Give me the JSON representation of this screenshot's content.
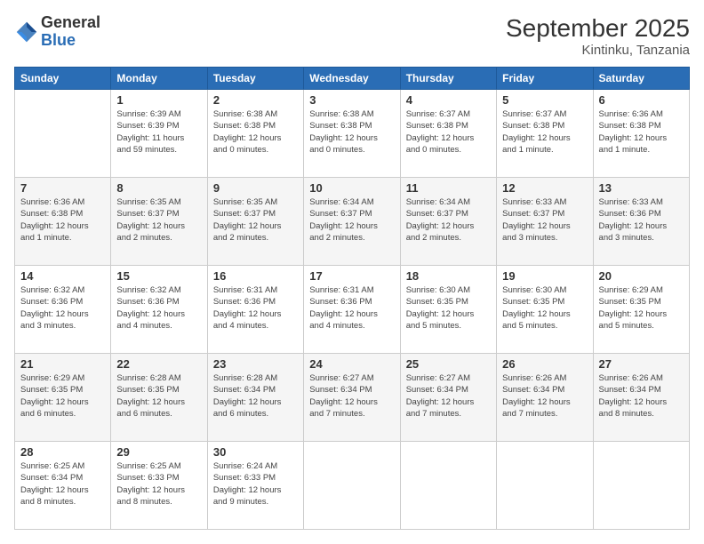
{
  "logo": {
    "general": "General",
    "blue": "Blue"
  },
  "header": {
    "title": "September 2025",
    "subtitle": "Kintinku, Tanzania"
  },
  "calendar": {
    "days_of_week": [
      "Sunday",
      "Monday",
      "Tuesday",
      "Wednesday",
      "Thursday",
      "Friday",
      "Saturday"
    ],
    "weeks": [
      [
        {
          "day": "",
          "info": ""
        },
        {
          "day": "1",
          "info": "Sunrise: 6:39 AM\nSunset: 6:39 PM\nDaylight: 11 hours\nand 59 minutes."
        },
        {
          "day": "2",
          "info": "Sunrise: 6:38 AM\nSunset: 6:38 PM\nDaylight: 12 hours\nand 0 minutes."
        },
        {
          "day": "3",
          "info": "Sunrise: 6:38 AM\nSunset: 6:38 PM\nDaylight: 12 hours\nand 0 minutes."
        },
        {
          "day": "4",
          "info": "Sunrise: 6:37 AM\nSunset: 6:38 PM\nDaylight: 12 hours\nand 0 minutes."
        },
        {
          "day": "5",
          "info": "Sunrise: 6:37 AM\nSunset: 6:38 PM\nDaylight: 12 hours\nand 1 minute."
        },
        {
          "day": "6",
          "info": "Sunrise: 6:36 AM\nSunset: 6:38 PM\nDaylight: 12 hours\nand 1 minute."
        }
      ],
      [
        {
          "day": "7",
          "info": "Sunrise: 6:36 AM\nSunset: 6:38 PM\nDaylight: 12 hours\nand 1 minute."
        },
        {
          "day": "8",
          "info": "Sunrise: 6:35 AM\nSunset: 6:37 PM\nDaylight: 12 hours\nand 2 minutes."
        },
        {
          "day": "9",
          "info": "Sunrise: 6:35 AM\nSunset: 6:37 PM\nDaylight: 12 hours\nand 2 minutes."
        },
        {
          "day": "10",
          "info": "Sunrise: 6:34 AM\nSunset: 6:37 PM\nDaylight: 12 hours\nand 2 minutes."
        },
        {
          "day": "11",
          "info": "Sunrise: 6:34 AM\nSunset: 6:37 PM\nDaylight: 12 hours\nand 2 minutes."
        },
        {
          "day": "12",
          "info": "Sunrise: 6:33 AM\nSunset: 6:37 PM\nDaylight: 12 hours\nand 3 minutes."
        },
        {
          "day": "13",
          "info": "Sunrise: 6:33 AM\nSunset: 6:36 PM\nDaylight: 12 hours\nand 3 minutes."
        }
      ],
      [
        {
          "day": "14",
          "info": "Sunrise: 6:32 AM\nSunset: 6:36 PM\nDaylight: 12 hours\nand 3 minutes."
        },
        {
          "day": "15",
          "info": "Sunrise: 6:32 AM\nSunset: 6:36 PM\nDaylight: 12 hours\nand 4 minutes."
        },
        {
          "day": "16",
          "info": "Sunrise: 6:31 AM\nSunset: 6:36 PM\nDaylight: 12 hours\nand 4 minutes."
        },
        {
          "day": "17",
          "info": "Sunrise: 6:31 AM\nSunset: 6:36 PM\nDaylight: 12 hours\nand 4 minutes."
        },
        {
          "day": "18",
          "info": "Sunrise: 6:30 AM\nSunset: 6:35 PM\nDaylight: 12 hours\nand 5 minutes."
        },
        {
          "day": "19",
          "info": "Sunrise: 6:30 AM\nSunset: 6:35 PM\nDaylight: 12 hours\nand 5 minutes."
        },
        {
          "day": "20",
          "info": "Sunrise: 6:29 AM\nSunset: 6:35 PM\nDaylight: 12 hours\nand 5 minutes."
        }
      ],
      [
        {
          "day": "21",
          "info": "Sunrise: 6:29 AM\nSunset: 6:35 PM\nDaylight: 12 hours\nand 6 minutes."
        },
        {
          "day": "22",
          "info": "Sunrise: 6:28 AM\nSunset: 6:35 PM\nDaylight: 12 hours\nand 6 minutes."
        },
        {
          "day": "23",
          "info": "Sunrise: 6:28 AM\nSunset: 6:34 PM\nDaylight: 12 hours\nand 6 minutes."
        },
        {
          "day": "24",
          "info": "Sunrise: 6:27 AM\nSunset: 6:34 PM\nDaylight: 12 hours\nand 7 minutes."
        },
        {
          "day": "25",
          "info": "Sunrise: 6:27 AM\nSunset: 6:34 PM\nDaylight: 12 hours\nand 7 minutes."
        },
        {
          "day": "26",
          "info": "Sunrise: 6:26 AM\nSunset: 6:34 PM\nDaylight: 12 hours\nand 7 minutes."
        },
        {
          "day": "27",
          "info": "Sunrise: 6:26 AM\nSunset: 6:34 PM\nDaylight: 12 hours\nand 8 minutes."
        }
      ],
      [
        {
          "day": "28",
          "info": "Sunrise: 6:25 AM\nSunset: 6:34 PM\nDaylight: 12 hours\nand 8 minutes."
        },
        {
          "day": "29",
          "info": "Sunrise: 6:25 AM\nSunset: 6:33 PM\nDaylight: 12 hours\nand 8 minutes."
        },
        {
          "day": "30",
          "info": "Sunrise: 6:24 AM\nSunset: 6:33 PM\nDaylight: 12 hours\nand 9 minutes."
        },
        {
          "day": "",
          "info": ""
        },
        {
          "day": "",
          "info": ""
        },
        {
          "day": "",
          "info": ""
        },
        {
          "day": "",
          "info": ""
        }
      ]
    ]
  }
}
